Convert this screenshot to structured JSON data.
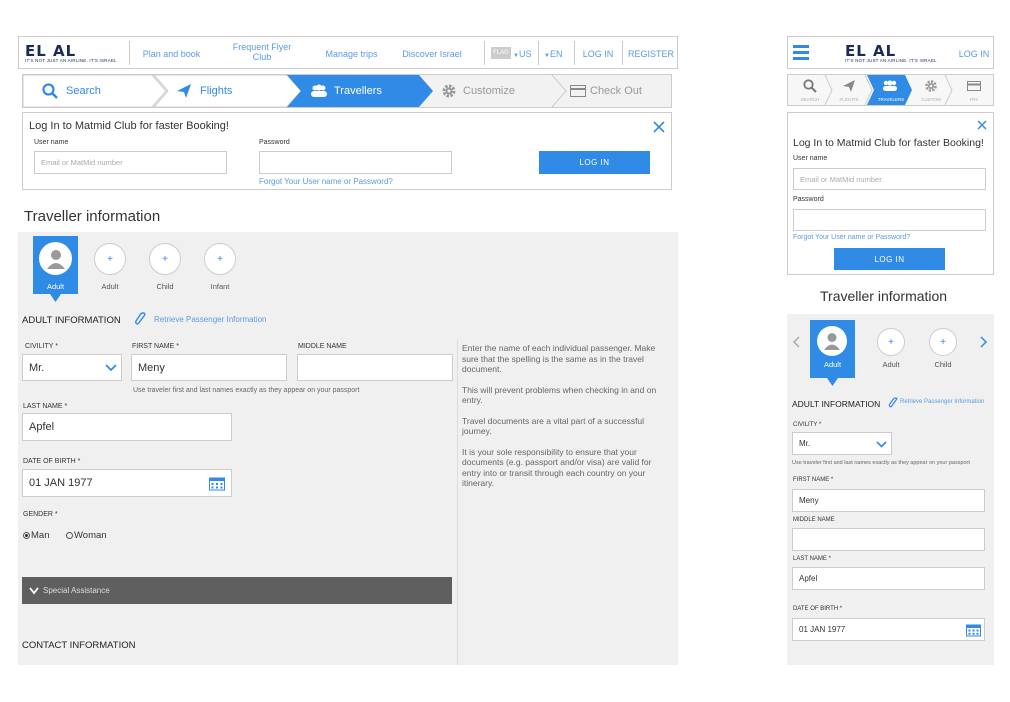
{
  "brand": {
    "logo": "EL AL",
    "tagline": "IT'S NOT JUST AN AIRLINE. IT'S ISRAEL"
  },
  "nav": {
    "plan": "Plan and book",
    "ffc1": "Frequent Flyer",
    "ffc2": "Club",
    "manage": "Manage trips",
    "discover": "Discover Israel",
    "flag": "FLAG",
    "country": "US",
    "lang": "EN",
    "login": "LOG IN",
    "register": "REGISTER"
  },
  "steps": {
    "search": "Search",
    "flights": "Flights",
    "travellers": "Travellers",
    "customize": "Customize",
    "checkout": "Check Out"
  },
  "login": {
    "title": "Log In to Matmid Club for faster Booking!",
    "user_label": "User name",
    "user_placeholder": "Email or MatMid number",
    "pass_label": "Password",
    "forgot": "Forgot Your User name or Password?",
    "button": "LOG IN"
  },
  "traveller": {
    "title_light": "Traveller ",
    "title_bold": "information"
  },
  "passengers": [
    {
      "label": "Adult"
    },
    {
      "label": "Adult",
      "plus": "+"
    },
    {
      "label": "Child",
      "plus": "+"
    },
    {
      "label": "Infant",
      "plus": "+"
    }
  ],
  "form": {
    "section": "ADULT INFORMATION",
    "retrieve": "Retrieve Passenger Information",
    "civility_label": "CIVILITY *",
    "civility_value": "Mr.",
    "first_label": "FIRST NAME *",
    "first_value": "Meny",
    "middle_label": "MIDDLE NAME",
    "hint": "Use traveler first and last names exactly as they appear on your passport",
    "last_label": "LAST NAME *",
    "last_value": "Apfel",
    "dob_label": "DATE OF BIRTH *",
    "dob_value": "01 JAN 1977",
    "gender_label": "GENDER *",
    "man": "Man",
    "woman": "Woman",
    "special": "Special Assistance",
    "contact": "CONTACT INFORMATION"
  },
  "help": {
    "p1": "Enter the name of each individual passenger. Make sure that the spelling is the same as in the travel document.",
    "p2": "This will prevent problems when checking in and on entry.",
    "p3": "Travel documents are a vital part of a successful journey.",
    "p4": "It is your sole responsibility to ensure that your documents (e.g. passport and/or visa) are valid for entry into or transit through each country on your itinerary."
  },
  "mobile": {
    "login": "LOG IN",
    "steps": [
      "SEARCH",
      "FLIGHTS",
      "TRAVELERS",
      "CUSTOM",
      "PAY"
    ]
  },
  "colors": {
    "accent": "#2f8be6",
    "dark_bar": "#5f5f5f",
    "panel_gray": "#f0f0f0",
    "brand_navy": "#1a2a5a",
    "brand_gold": "#c8a54a"
  }
}
